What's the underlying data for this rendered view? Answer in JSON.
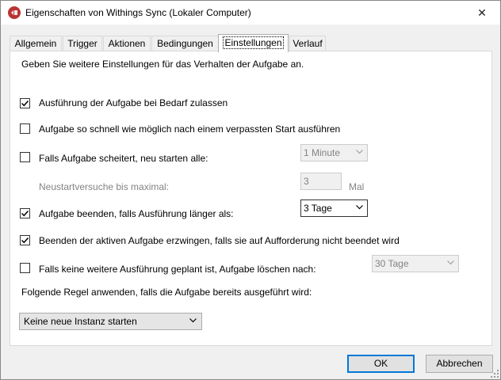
{
  "window": {
    "title": "Eigenschaften von Withings Sync (Lokaler Computer)",
    "close_glyph": "✕"
  },
  "tabs": [
    {
      "label": "Allgemein"
    },
    {
      "label": "Trigger"
    },
    {
      "label": "Aktionen"
    },
    {
      "label": "Bedingungen"
    },
    {
      "label": "Einstellungen"
    },
    {
      "label": "Verlauf"
    }
  ],
  "active_tab": "Einstellungen",
  "settings": {
    "intro": "Geben Sie weitere Einstellungen für das Verhalten der Aufgabe an.",
    "run_on_demand": {
      "label": "Ausführung der Aufgabe bei Bedarf zulassen",
      "checked": true
    },
    "run_missed": {
      "label": "Aufgabe so schnell wie möglich nach einem verpassten Start ausführen",
      "checked": false
    },
    "restart_on_fail": {
      "label": "Falls Aufgabe scheitert, neu starten alle:",
      "checked": false,
      "interval_value": "1 Minute"
    },
    "max_retries": {
      "label": "Neustartversuche bis maximal:",
      "value": "3",
      "unit": "Mal"
    },
    "stop_if_longer": {
      "label": "Aufgabe beenden, falls Ausführung länger als:",
      "checked": true,
      "value": "3 Tage"
    },
    "force_stop": {
      "label": "Beenden der aktiven Aufgabe erzwingen, falls sie auf Aufforderung nicht beendet wird",
      "checked": true
    },
    "delete_if_not_scheduled": {
      "label": "Falls keine weitere Ausführung geplant ist, Aufgabe löschen nach:",
      "checked": false,
      "value": "30 Tage"
    },
    "rule_label": "Folgende Regel anwenden, falls die Aufgabe bereits ausgeführt wird:",
    "rule_value": "Keine neue Instanz starten"
  },
  "buttons": {
    "ok": "OK",
    "cancel": "Abbrechen"
  },
  "colors": {
    "accent": "#0078d7",
    "disabled_text": "#838383"
  },
  "icons": {
    "app": "withings-app-icon",
    "close": "close-icon",
    "check": "checkmark-icon",
    "dropdown": "chevron-down-icon"
  }
}
